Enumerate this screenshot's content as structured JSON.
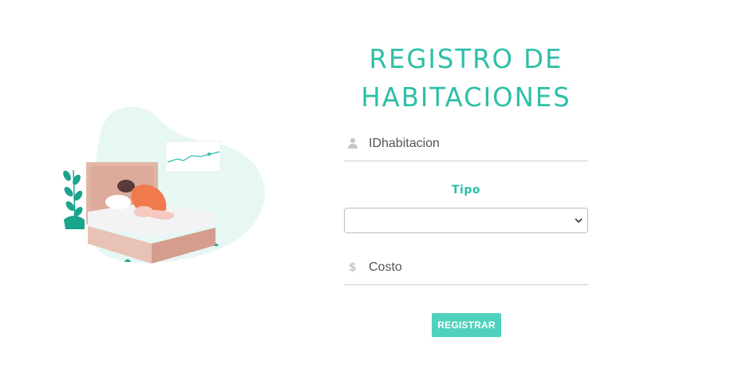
{
  "form": {
    "title_line1": "REGISTRO DE",
    "title_line2": "HABITACIONES",
    "id_field": {
      "placeholder": "IDhabitacion",
      "icon": "user-icon"
    },
    "tipo_label": "Tipo",
    "tipo_select": {
      "selected": "",
      "options": [
        ""
      ]
    },
    "costo_field": {
      "placeholder": "Costo",
      "icon": "dollar-icon"
    },
    "submit_label": "REGISTRAR"
  },
  "colors": {
    "accent": "#2dbfa7",
    "button": "#4fd1bd",
    "blob": "#e6f7f4",
    "bed_frame": "#e2b6a6",
    "bed_side": "#d49d8d",
    "sweater": "#f07a4e"
  },
  "illustration": {
    "name": "person-sleeping-on-bed-illustration"
  }
}
